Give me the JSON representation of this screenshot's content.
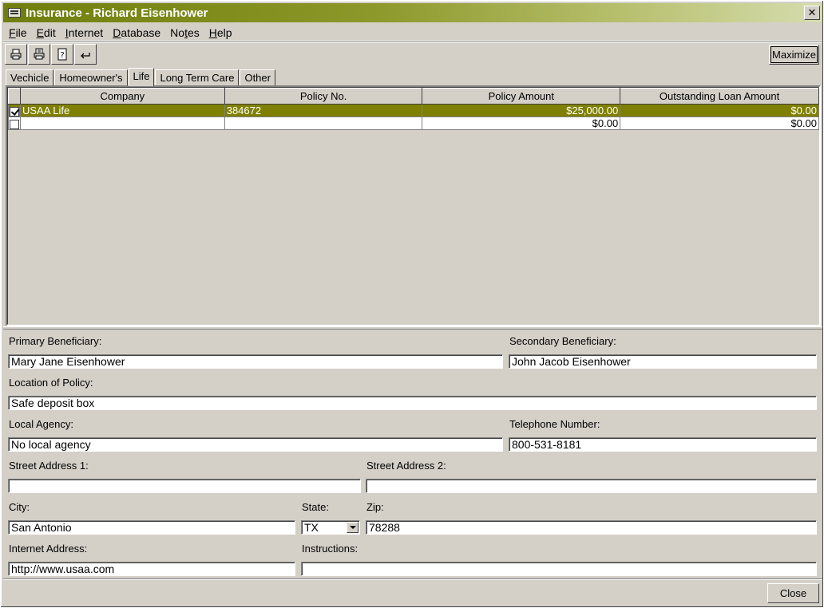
{
  "window": {
    "title": "Insurance - Richard Eisenhower",
    "close_glyph": "✕"
  },
  "menu": [
    {
      "label": "File",
      "accel": "F",
      "rest": "ile"
    },
    {
      "label": "Edit",
      "accel": "E",
      "rest": "dit"
    },
    {
      "label": "Internet",
      "accel": "I",
      "rest": "nternet"
    },
    {
      "label": "Database",
      "accel": "D",
      "rest": "atabase"
    },
    {
      "label": "Notes",
      "pre": "No",
      "accel": "t",
      "rest": "es"
    },
    {
      "label": "Help",
      "accel": "H",
      "rest": "elp"
    }
  ],
  "toolbar": {
    "maximize_label": "Maximize",
    "icons": [
      "print-icon",
      "print-preview-icon",
      "help-icon",
      "back-arrow-icon"
    ]
  },
  "tabs": [
    "Vechicle",
    "Homeowner's",
    "Life",
    "Long Term Care",
    "Other"
  ],
  "active_tab": "Life",
  "grid": {
    "columns": [
      "Company",
      "Policy No.",
      "Policy Amount",
      "Outstanding Loan Amount"
    ],
    "rows": [
      {
        "checked": true,
        "company": "USAA Life",
        "policy_no": "384672",
        "amount": "$25,000.00",
        "loan": "$0.00",
        "selected": true
      },
      {
        "checked": false,
        "company": "",
        "policy_no": "",
        "amount": "$0.00",
        "loan": "$0.00",
        "selected": false
      }
    ]
  },
  "form": {
    "primary_beneficiary_label": "Primary Beneficiary:",
    "primary_beneficiary": "Mary Jane Eisenhower",
    "secondary_beneficiary_label": "Secondary Beneficiary:",
    "secondary_beneficiary": "John Jacob Eisenhower",
    "location_label": "Location of Policy:",
    "location": "Safe deposit box",
    "agency_label": "Local Agency:",
    "agency": "No local agency",
    "phone_label": "Telephone Number:",
    "phone": "800-531-8181",
    "street1_label": "Street Address 1:",
    "street1": "",
    "street2_label": "Street Address 2:",
    "street2": "",
    "city_label": "City:",
    "city": "San Antonio",
    "state_label": "State:",
    "state": "TX",
    "zip_label": "Zip:",
    "zip": "78288",
    "internet_label": "Internet Address:",
    "internet": "http://www.usaa.com",
    "instructions_label": "Instructions:",
    "instructions": ""
  },
  "footer": {
    "close_label": "Close"
  },
  "colors": {
    "title_gradient_start": "#6f7e0c",
    "selected_row": "#808000",
    "face": "#d4d0c8"
  }
}
